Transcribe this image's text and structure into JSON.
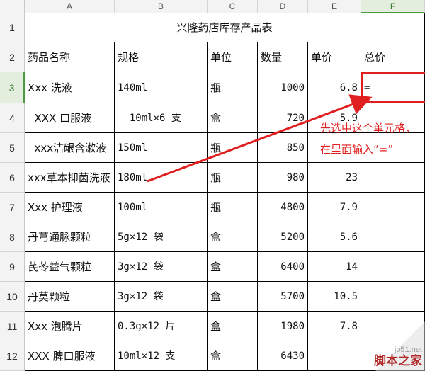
{
  "columns": [
    "A",
    "B",
    "C",
    "D",
    "E",
    "F"
  ],
  "rows": [
    "1",
    "2",
    "3",
    "4",
    "5",
    "6",
    "7",
    "8",
    "9",
    "10",
    "11",
    "12"
  ],
  "title": "兴隆药店库存产品表",
  "headers": {
    "name": "药品名称",
    "spec": "规格",
    "unit": "单位",
    "qty": "数量",
    "price": "单价",
    "total": "总价"
  },
  "items": [
    {
      "name": "Xxx 洗液",
      "spec": "140ml",
      "unit": "瓶",
      "qty": "1000",
      "price": "6.8",
      "total": "="
    },
    {
      "name": "  XXX 口服液",
      "spec": "  10ml×6 支",
      "unit": "盒",
      "qty": "720",
      "price": "5.9",
      "total": ""
    },
    {
      "name": "  xxx洁龈含漱液",
      "spec": "150ml",
      "unit": "瓶",
      "qty": "850",
      "price": "",
      "total": ""
    },
    {
      "name": "xxx草本抑菌洗液",
      "spec": "180ml",
      "unit": "瓶",
      "qty": "980",
      "price": "23",
      "total": ""
    },
    {
      "name": "Xxx 护理液",
      "spec": "100ml",
      "unit": "瓶",
      "qty": "4800",
      "price": "7.9",
      "total": ""
    },
    {
      "name": "丹芎通脉颗粒",
      "spec": "5g×12 袋",
      "unit": "盒",
      "qty": "5200",
      "price": "5.6",
      "total": ""
    },
    {
      "name": "芪苓益气颗粒",
      "spec": "3g×12 袋",
      "unit": "盒",
      "qty": "6400",
      "price": "14",
      "total": ""
    },
    {
      "name": "丹莫颗粒",
      "spec": "3g×12 袋",
      "unit": "盒",
      "qty": "5700",
      "price": "10.5",
      "total": ""
    },
    {
      "name": "Xxx 泡腾片",
      "spec": "0.3g×12 片",
      "unit": "盒",
      "qty": "1980",
      "price": "7.8",
      "total": ""
    },
    {
      "name": "XXX 脾口服液",
      "spec": "10ml×12 支",
      "unit": "盒",
      "qty": "6430",
      "price": "",
      "total": ""
    }
  ],
  "annotation": {
    "line1": "先选中这个单元格，",
    "line2": "在里面输入“=”"
  },
  "watermark": {
    "site": "jb51.net",
    "brand": "脚本之家"
  },
  "colors": {
    "accent": "#e02020",
    "selected_header": "#4a9a3e"
  }
}
